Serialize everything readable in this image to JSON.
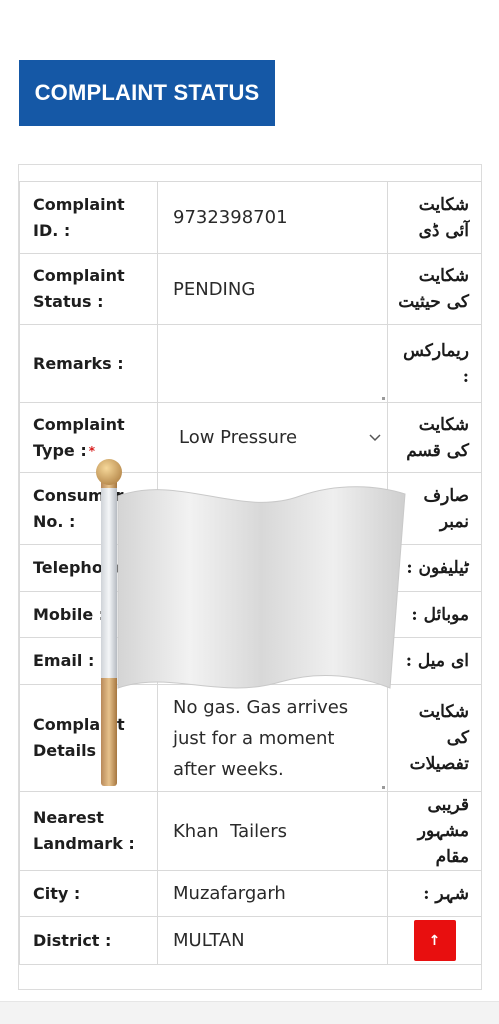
{
  "header": {
    "title": "COMPLAINT STATUS"
  },
  "rows": [
    {
      "label": "Complaint ID. :",
      "value": "9732398701",
      "urdu": "شکایت آئی ڈی"
    },
    {
      "label": "Complaint Status :",
      "value": "PENDING",
      "urdu": "شکایت کی حیثیت"
    },
    {
      "label": "Remarks :",
      "value": "",
      "urdu": "ریمارکس :"
    },
    {
      "label": "Complaint Type :",
      "required_mark": "*",
      "value": "Low Pressure",
      "urdu": "شکایت کی قسم"
    },
    {
      "label": "Consumer No. :",
      "value": "",
      "urdu": "صارف نمبر"
    },
    {
      "label": "Telephone :",
      "value": "",
      "urdu": "ٹیلیفون :"
    },
    {
      "label": "Mobile :",
      "value": "",
      "urdu": "موبائل :"
    },
    {
      "label": "Email :",
      "value": "",
      "urdu": "ای میل :"
    },
    {
      "label": "Complaint Details :",
      "value": "No gas. Gas arrives just for a moment after weeks.",
      "urdu": "شکایت کی تفصیلات"
    },
    {
      "label": "Nearest Landmark :",
      "value": "Khan  Tailers",
      "urdu": "قریبی مشہور مقام"
    },
    {
      "label": "City :",
      "value": "Muzafargarh",
      "urdu": "شہر :"
    },
    {
      "label": "District :",
      "value": "MULTAN",
      "urdu": ""
    }
  ],
  "scroll_top_button": {
    "icon": "arrow-up-icon",
    "glyph": "↑",
    "color": "#e80f0f"
  },
  "overlay": {
    "icon": "white-flag-icon"
  },
  "colors": {
    "header_bg": "#1558a6",
    "required": "#d81b1b"
  }
}
